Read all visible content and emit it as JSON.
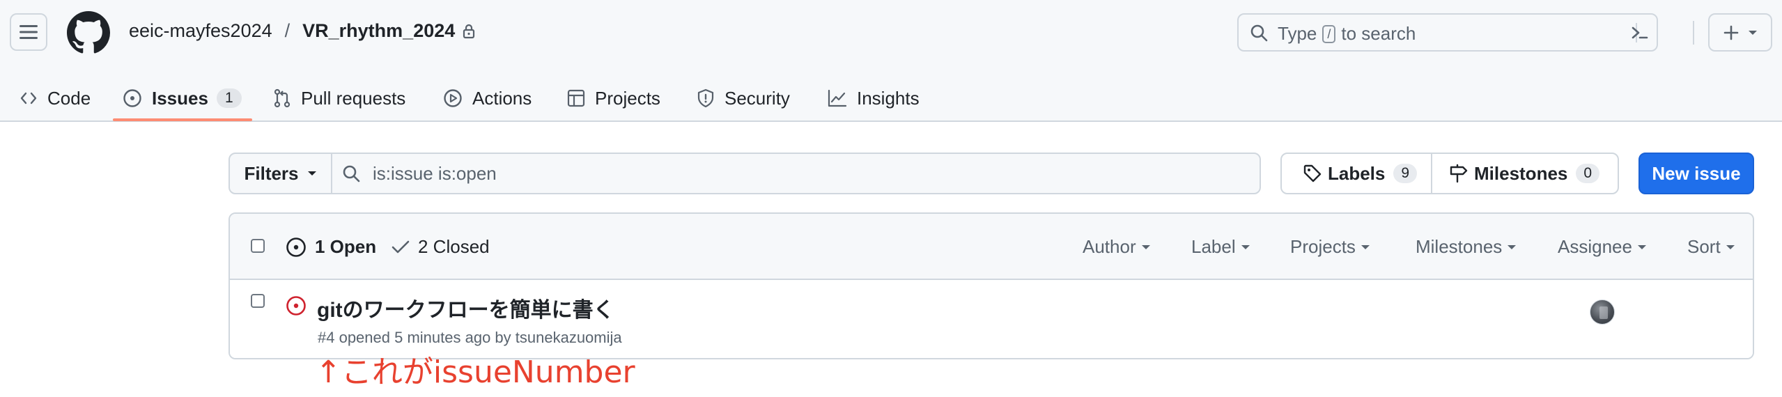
{
  "header": {
    "owner": "eeic-mayfes2024",
    "separator": "/",
    "repo": "VR_rhythm_2024",
    "search": {
      "type_label": "Type",
      "key": "/",
      "suffix": "to search"
    }
  },
  "tabs": [
    {
      "label": "Code",
      "icon": "code-icon"
    },
    {
      "label": "Issues",
      "icon": "issue-opened-icon",
      "count": "1",
      "selected": true
    },
    {
      "label": "Pull requests",
      "icon": "git-pull-request-icon"
    },
    {
      "label": "Actions",
      "icon": "play-icon"
    },
    {
      "label": "Projects",
      "icon": "table-icon"
    },
    {
      "label": "Security",
      "icon": "shield-icon"
    },
    {
      "label": "Insights",
      "icon": "graph-icon"
    }
  ],
  "filterbar": {
    "filters_label": "Filters",
    "query": "is:issue is:open",
    "labels_label": "Labels",
    "labels_count": "9",
    "milestones_label": "Milestones",
    "milestones_count": "0",
    "new_issue_label": "New issue"
  },
  "list": {
    "open_label": "1 Open",
    "closed_label": "2 Closed",
    "filters": [
      "Author",
      "Label",
      "Projects",
      "Milestones",
      "Assignee",
      "Sort"
    ],
    "issues": [
      {
        "title": "gitのワークフローを簡単に書く",
        "meta": "#4 opened 5 minutes ago by tsunekazuomija",
        "state": "open"
      }
    ]
  },
  "annotation": "↑これがissueNumber",
  "colors": {
    "accent": "#1f6feb",
    "open_issue": "#cf222e",
    "tab_underline": "#fd8c73",
    "annotation": "#e8412f"
  }
}
